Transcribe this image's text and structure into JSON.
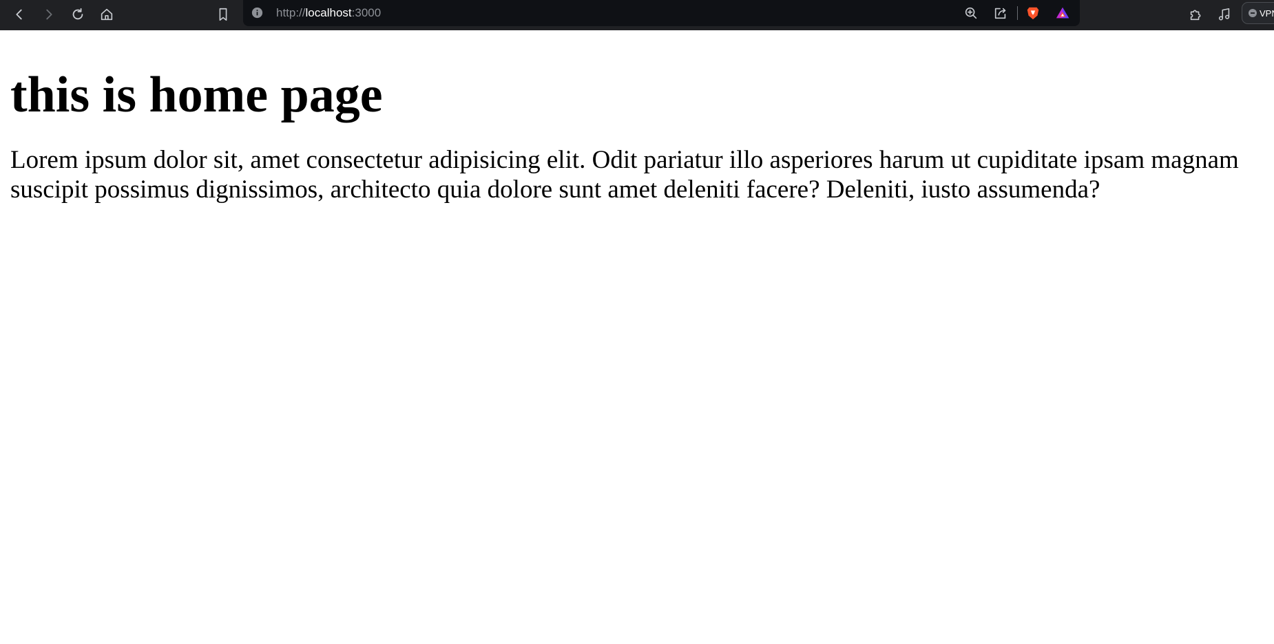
{
  "browser": {
    "url_scheme": "http://",
    "url_host": "localhost",
    "url_port": ":3000",
    "vpn_label": "VPN",
    "icons": [
      "back-icon",
      "forward-icon",
      "reload-icon",
      "home-icon",
      "bookmark-icon",
      "info-icon",
      "zoom-icon",
      "share-icon",
      "brave-shields-icon",
      "brave-rewards-icon",
      "extensions-icon",
      "media-icon"
    ],
    "colors": {
      "toolbar": "#202124",
      "addressbar": "#0f1115",
      "shields": "#fb542b"
    }
  },
  "main": {
    "heading": "this is home page",
    "paragraph": "Lorem ipsum dolor sit, amet consectetur adipisicing elit. Odit pariatur illo asperiores harum ut cupiditate ipsam magnam suscipit possimus dignissimos, architecto quia dolore sunt amet deleniti facere? Deleniti, iusto assumenda?"
  }
}
